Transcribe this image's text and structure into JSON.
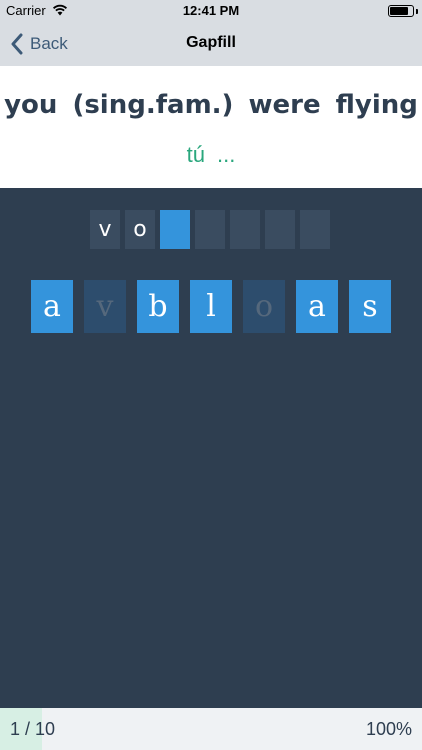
{
  "status_bar": {
    "carrier": "Carrier",
    "time": "12:41 PM",
    "battery_level": 0.8
  },
  "nav": {
    "back_label": "Back",
    "title": "Gapfill"
  },
  "prompt": {
    "english": "you (sing.fam.) were flying",
    "hint": "tú ..."
  },
  "answer": {
    "letters": [
      "v",
      "o",
      "",
      "",
      "",
      "",
      ""
    ],
    "active_index": 2
  },
  "tiles": [
    {
      "letter": "a",
      "used": false
    },
    {
      "letter": "v",
      "used": true
    },
    {
      "letter": "b",
      "used": false
    },
    {
      "letter": "l",
      "used": false
    },
    {
      "letter": "o",
      "used": true
    },
    {
      "letter": "a",
      "used": false
    },
    {
      "letter": "s",
      "used": false
    }
  ],
  "footer": {
    "current": "1",
    "separator": " / ",
    "total": "10",
    "score": "100%",
    "progress": 0.1
  },
  "colors": {
    "background": "#2e3e50",
    "accent": "#3494dc",
    "hint": "#2aa77d",
    "tile_used": "#2d4d6d"
  }
}
